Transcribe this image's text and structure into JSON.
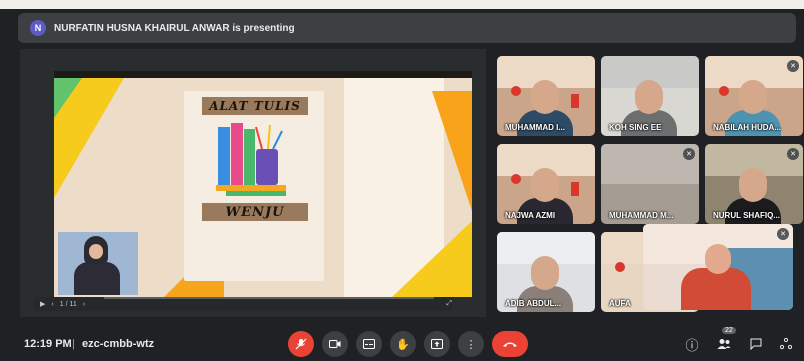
{
  "presenting_banner": {
    "badge_letter": "N",
    "text": "NURFATIN HUSNA KHAIRUL ANWAR is presenting"
  },
  "slide": {
    "title_top": "ALAT TULIS",
    "title_bottom": "WENJU",
    "page_indicator": "1 / 11"
  },
  "participants": [
    {
      "name": "MUHAMMAD I..."
    },
    {
      "name": "KOH SING EE"
    },
    {
      "name": "NABILAH HUDA..."
    },
    {
      "name": "NAJWA AZMI"
    },
    {
      "name": "MUHAMMAD M..."
    },
    {
      "name": "NURUL SHAFIQ..."
    },
    {
      "name": "ADIB ABDUL..."
    },
    {
      "name": "AUFA"
    }
  ],
  "meeting": {
    "time": "12:19 PM",
    "separator": "|",
    "code": "ezc-cmbb-wtz"
  },
  "controls": {
    "mic_icon": "mic-off-icon",
    "camera_icon": "camera-icon",
    "captions_icon": "captions-icon",
    "raise_hand_icon": "hand-icon",
    "present_icon": "present-icon",
    "more_icon": "more-vert-icon",
    "leave_icon": "phone-hangup-icon"
  },
  "right_controls": {
    "people_count": "22"
  },
  "colors": {
    "accent_red": "#ea4335",
    "bg": "#202124",
    "bar": "#3c4043"
  }
}
